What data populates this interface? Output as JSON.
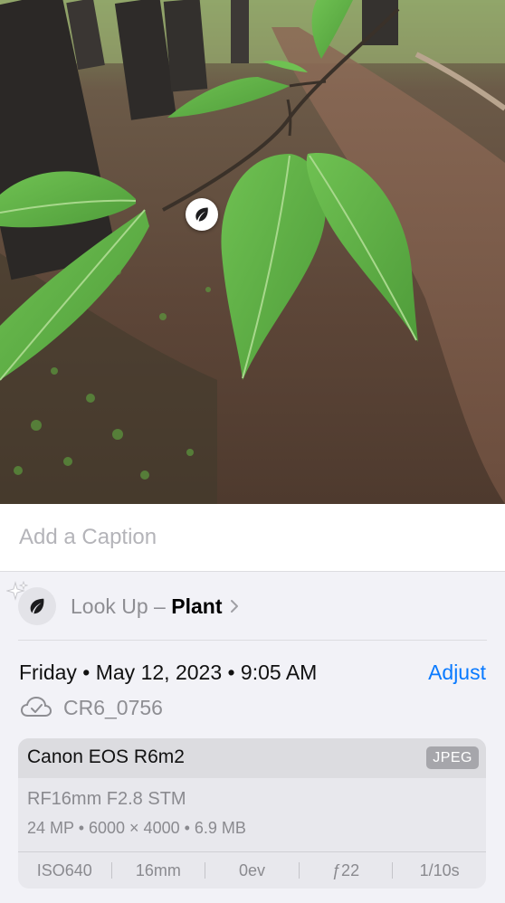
{
  "caption": {
    "placeholder": "Add a Caption"
  },
  "lookup": {
    "prefix": "Look Up – ",
    "subject": "Plant"
  },
  "datetime": {
    "text": "Friday • May 12, 2023 • 9:05 AM",
    "adjust_label": "Adjust"
  },
  "file": {
    "name": "CR6_0756"
  },
  "camera": {
    "model": "Canon EOS R6m2",
    "format": "JPEG",
    "lens": "RF16mm F2.8 STM",
    "specs": "24 MP • 6000 × 4000 • 6.9 MB",
    "exif": [
      "ISO640",
      "16mm",
      "0ev",
      "ƒ22",
      "1/10s"
    ]
  },
  "colors": {
    "accent": "#0a7aff",
    "secondary_text": "#8e8e93",
    "leaf": "#62b24c"
  },
  "icons": {
    "badge": "leaf-icon",
    "sparkle": "sparkle-icon",
    "cloud": "icloud-check-icon",
    "chevron": "chevron-right-icon"
  }
}
